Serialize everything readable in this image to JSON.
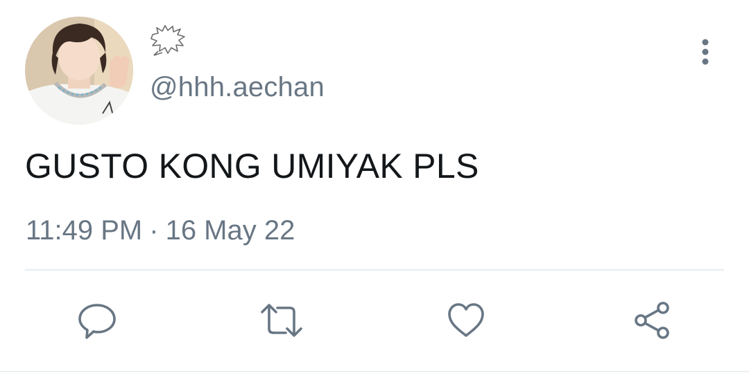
{
  "user": {
    "handle": "@hhh.aechan",
    "display_name_emoji": "speech-burst-icon",
    "avatar": "profile-photo"
  },
  "tweet": {
    "text": "GUSTO KONG UMIYAK PLS",
    "time": "11:49 PM",
    "separator": "·",
    "date": "16 May 22"
  },
  "actions": [
    {
      "name": "reply",
      "icon": "comment-bubble-icon"
    },
    {
      "name": "retweet",
      "icon": "retweet-icon"
    },
    {
      "name": "like",
      "icon": "heart-icon"
    },
    {
      "name": "share",
      "icon": "share-icon"
    }
  ],
  "menu": {
    "icon": "more-vertical-icon"
  },
  "colors": {
    "text": "#14171a",
    "secondary": "#687684",
    "divider": "#e6ecf0"
  }
}
